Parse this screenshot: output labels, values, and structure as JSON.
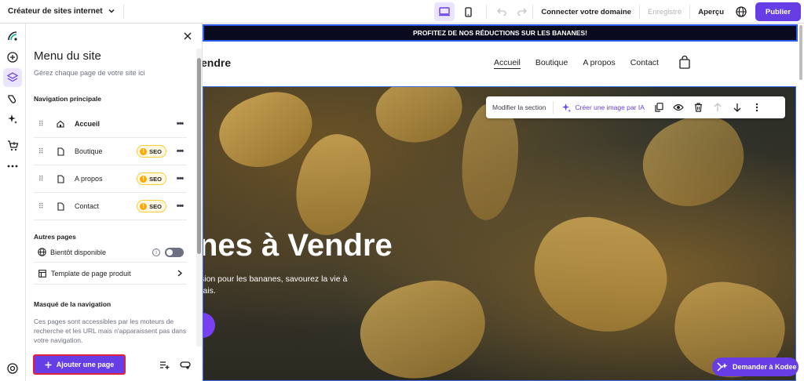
{
  "topbar": {
    "site_title": "Créateur de sites internet",
    "connect_domain": "Connecter votre domaine",
    "saved_status": "Enregistré",
    "preview": "Aperçu",
    "publish": "Publier"
  },
  "panel": {
    "title": "Menu du site",
    "subtitle": "Gérez chaque page de votre site ici",
    "main_nav_heading": "Navigation principale",
    "main_nav_items": [
      {
        "label": "Accueil",
        "icon": "home-icon",
        "seo": ""
      },
      {
        "label": "Boutique",
        "icon": "page-icon",
        "seo": "SEO"
      },
      {
        "label": "A propos",
        "icon": "page-icon",
        "seo": "SEO"
      },
      {
        "label": "Contact",
        "icon": "page-icon",
        "seo": "SEO"
      }
    ],
    "other_pages_heading": "Autres pages",
    "coming_soon": "Bientôt disponible",
    "product_template": "Template de page produit",
    "hidden_heading": "Masqué de la navigation",
    "hidden_description": "Ces pages sont accessibles par les moteurs de recherche et les URL mais n'apparaissent pas dans votre navigation.",
    "add_page": "Ajouter une page"
  },
  "canvas": {
    "promo": "PROFITEZ DE NOS RÉDUCTIONS SUR LES BANANES!",
    "logo": "endre",
    "nav": [
      "Accueil",
      "Boutique",
      "A propos",
      "Contact"
    ],
    "hero_title": "nes à Vendre",
    "hero_line1": "sion pour les bananes, savourez la vie à",
    "hero_line2": "rais.",
    "section_toolbar": {
      "edit": "Modifier la section",
      "ai": "Créer une image par IA"
    }
  },
  "kodee": "Demander à Kodee",
  "colors": {
    "accent": "#673de6",
    "seo_badge": "#ffa800",
    "highlight_border": "#e0213b"
  }
}
